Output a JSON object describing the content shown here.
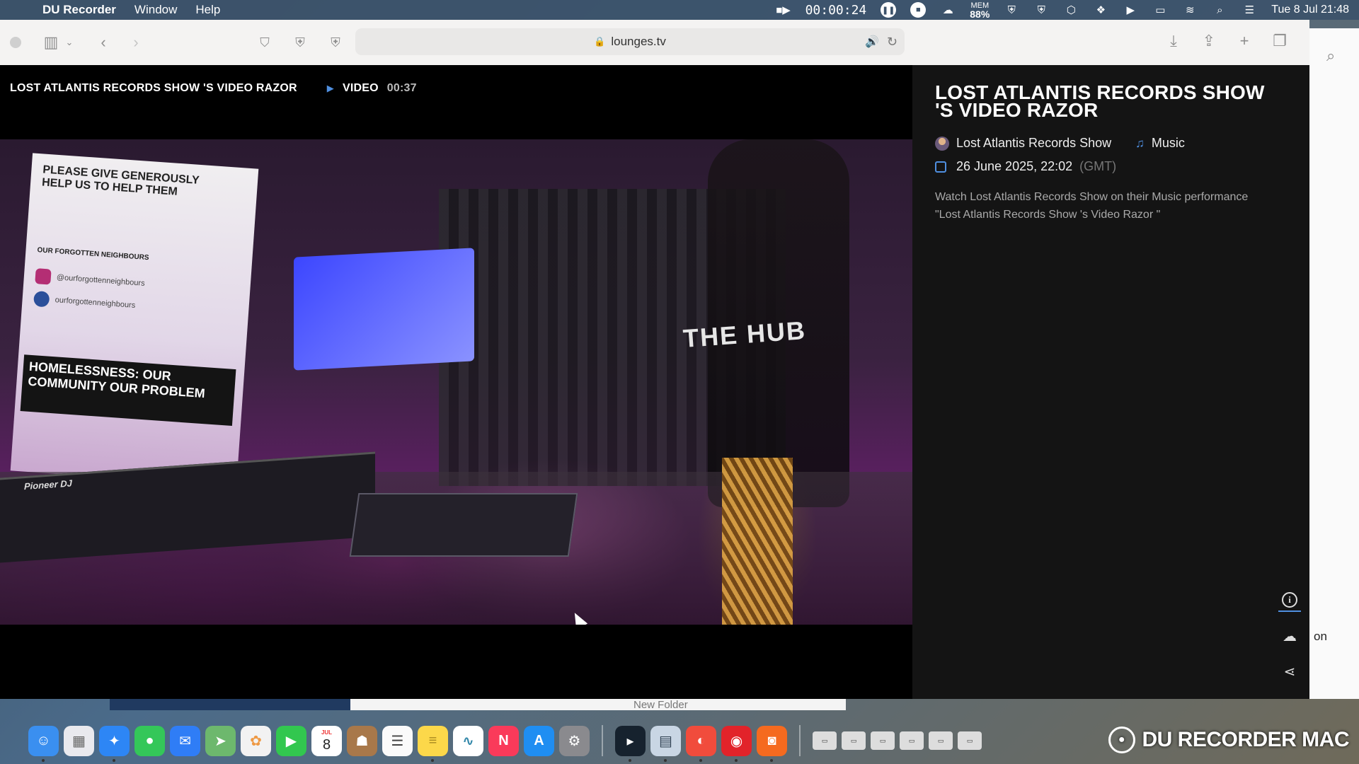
{
  "menubar": {
    "app_name": "DU Recorder",
    "menus": [
      "Window",
      "Help"
    ],
    "rec_timer": "00:00:24",
    "mem_label": "MEM",
    "mem_value": "88%",
    "datetime": "Tue 8 Jul  21:48"
  },
  "browser": {
    "url": "lounges.tv"
  },
  "player": {
    "title": "LOST ATLANTIS RECORDS SHOW 'S VIDEO RAZOR",
    "type_label": "VIDEO",
    "duration": "00:37"
  },
  "info": {
    "title": "LOST ATLANTIS RECORDS SHOW 'S VIDEO RAZOR",
    "channel": "Lost Atlantis Records Show",
    "category": "Music",
    "date": "26 June 2025, 22:02",
    "timezone": "(GMT)",
    "description": "Watch Lost Atlantis Records Show on their Music performance \"Lost Atlantis Records Show 's Video Razor \""
  },
  "video_scene": {
    "banner_lines": [
      "PLEASE GIVE GENEROUSLY",
      "HELP US TO HELP THEM"
    ],
    "banner_org": "OUR FORGOTTEN NEIGHBOURS",
    "banner_handle_ig": "@ourforgottenneighbours",
    "banner_handle_fb": "ourforgottenneighbours",
    "banner_slogan": "HOMELESSNESS: OUR COMMUNITY OUR PROBLEM",
    "mixer_brand": "Pioneer DJ",
    "wall_brand": "THE HUB"
  },
  "side_window": {
    "partial_text": "on"
  },
  "peek_windows": {
    "folder_label": "New Folder"
  },
  "dock": {
    "calendar_month": "JUL",
    "calendar_day": "8"
  },
  "watermark": {
    "text": "DU RECORDER MAC"
  },
  "colors": {
    "accent_blue": "#4f8fe0",
    "speaker_pink": "#d0146c",
    "panel_bg": "#141414"
  }
}
